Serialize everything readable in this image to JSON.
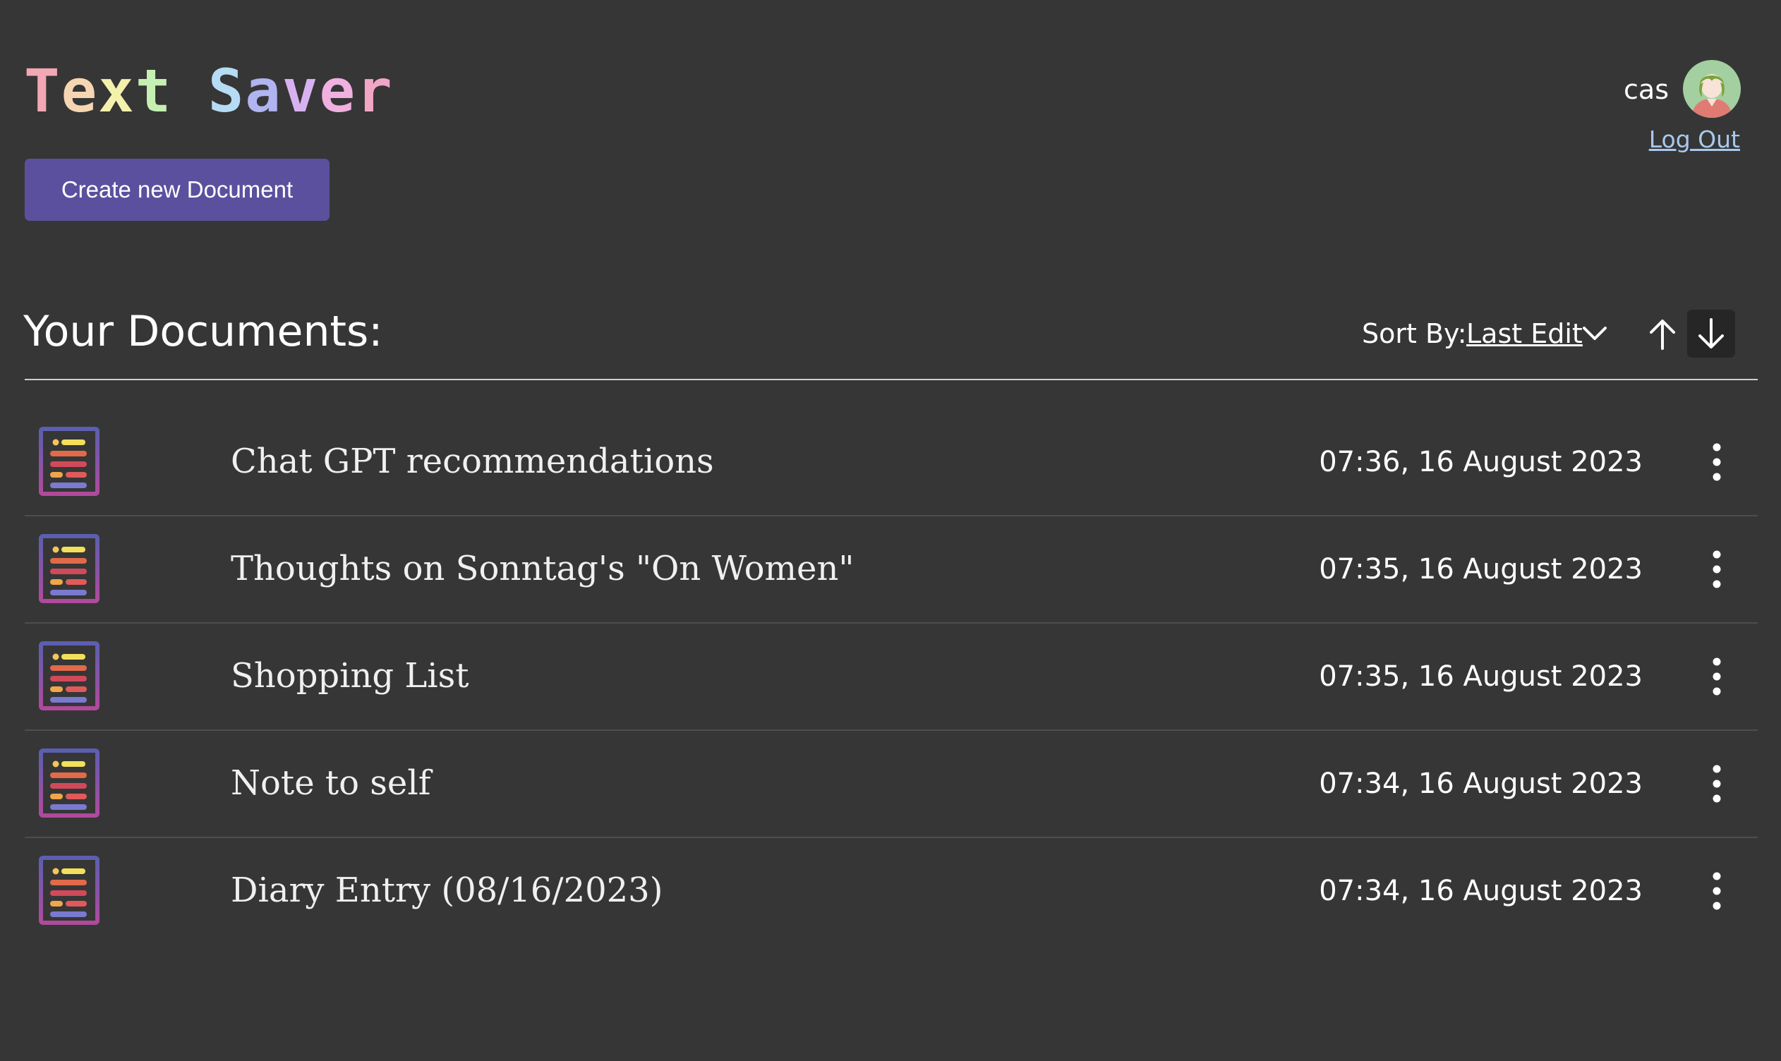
{
  "header": {
    "title_parts": [
      "T",
      "e",
      "x",
      "t",
      " ",
      "S",
      "a",
      "v",
      "e",
      "r"
    ],
    "title_colors": [
      "#f2a7b4",
      "#f6d6b2",
      "#f4f1ad",
      "#c6f0b2",
      "#ffffff",
      "#b6dcf4",
      "#b0b4f0",
      "#d8b2f0",
      "#f0b0e0",
      "#f2a6c6"
    ],
    "create_button_label": "Create new Document"
  },
  "user": {
    "name": "cas",
    "logout_label": "Log Out"
  },
  "documents_section": {
    "title": "Your Documents:",
    "sort_label": "Sort By:",
    "sort_value": "Last Edit",
    "sort_direction": "descending"
  },
  "documents": [
    {
      "title": "Chat GPT recommendations",
      "last_edit": "07:36, 16 August 2023"
    },
    {
      "title": "Thoughts on Sonntag's \"On Women\"",
      "last_edit": "07:35, 16 August 2023"
    },
    {
      "title": "Shopping List",
      "last_edit": "07:35, 16 August 2023"
    },
    {
      "title": "Note to self",
      "last_edit": "07:34, 16 August 2023"
    },
    {
      "title": "Diary Entry (08/16/2023)",
      "last_edit": "07:34, 16 August 2023"
    }
  ],
  "colors": {
    "background": "#363636",
    "accent_button": "#5b509e",
    "link": "#a9c8ec",
    "active_sort_bg": "#262626"
  },
  "icons": {
    "document": "document-list-icon",
    "menu": "vertical-ellipsis-icon",
    "sort_dropdown": "chevron-down-icon",
    "sort_ascending": "arrow-up-icon",
    "sort_descending": "arrow-down-icon"
  }
}
